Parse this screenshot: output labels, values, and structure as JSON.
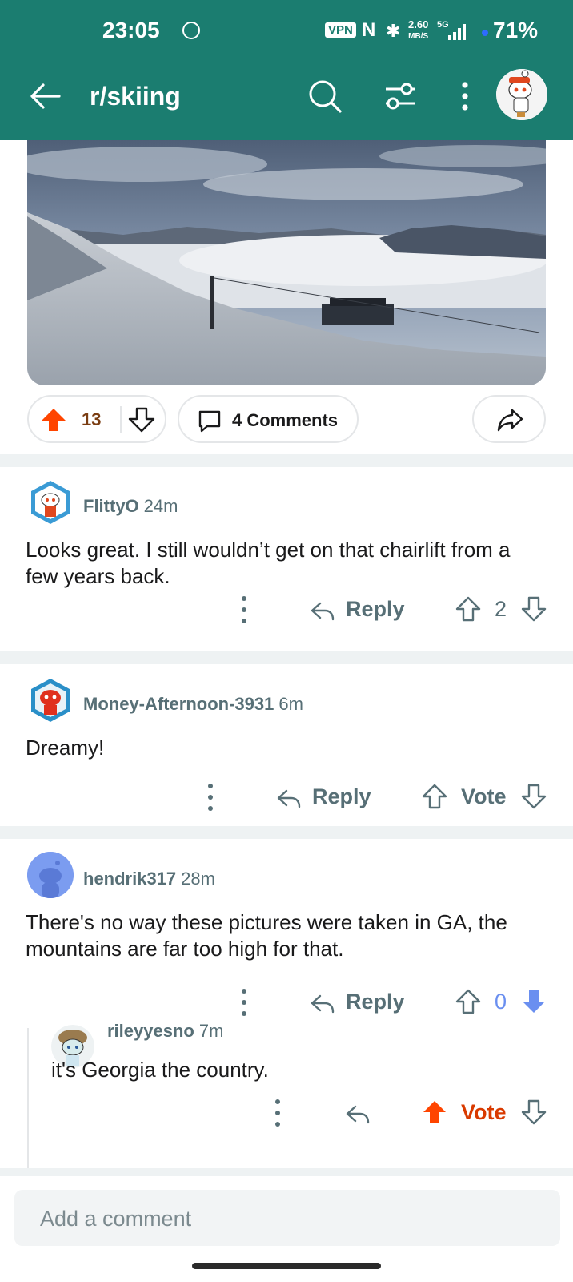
{
  "status_bar": {
    "time": "23:05",
    "vpn": "VPN",
    "nfc": "N",
    "speed_value": "2.60",
    "speed_unit": "MB/S",
    "network": "5G",
    "battery": "71%"
  },
  "app_bar": {
    "title": "r/skiing",
    "icons": [
      "back-arrow-icon",
      "search-icon",
      "filter-icon",
      "more-vertical-icon",
      "avatar"
    ]
  },
  "post": {
    "score": "13",
    "comments_label": "4 Comments",
    "vote_color": "#ff4500"
  },
  "comments": [
    {
      "user": "FlittyO",
      "time": "24m",
      "body": "Looks great.  I still wouldn’t get on that chairlift from a few years back.",
      "reply_label": "Reply",
      "votes": "2"
    },
    {
      "user": "Money-Afternoon-3931",
      "time": "6m",
      "body": "Dreamy!",
      "reply_label": "Reply",
      "votes": "Vote"
    },
    {
      "user": "hendrik317",
      "time": "28m",
      "body": "There's no way these pictures were taken in GA, the mountains are far too high for that.",
      "reply_label": "Reply",
      "votes": "0",
      "downvoted": true
    },
    {
      "user": "rileyyesno",
      "time": "7m",
      "body": "it's Georgia the country.",
      "votes": "Vote",
      "upvoted": true
    }
  ],
  "composer": {
    "placeholder": "Add a comment"
  },
  "colors": {
    "header": "#1b7d70",
    "upvote": "#ff4500",
    "downvote": "#6a8ff0",
    "meta": "#576f76"
  }
}
